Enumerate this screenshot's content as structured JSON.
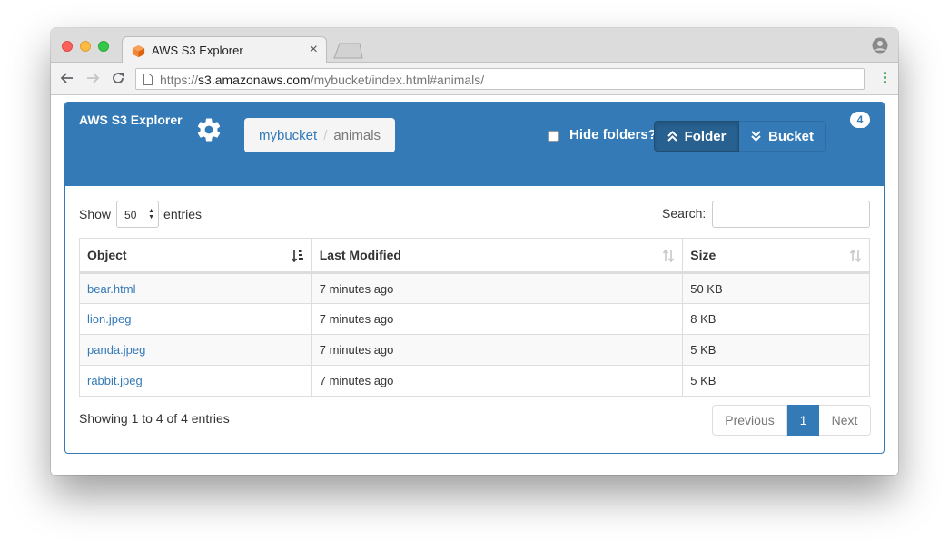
{
  "browser": {
    "tab_title": "AWS S3 Explorer",
    "tab_close": "×",
    "url_prefix": "https://",
    "url_host": "s3.amazonaws.com",
    "url_path": "/mybucket/index.html#animals/"
  },
  "header": {
    "brand": "AWS S3 Explorer",
    "breadcrumb": [
      "mybucket",
      "animals"
    ],
    "breadcrumb_sep": "/",
    "hide_folders_label": "Hide folders?",
    "hide_folders_checked": false,
    "folder_button": "Folder",
    "bucket_button": "Bucket",
    "object_count": "4"
  },
  "controls": {
    "show_label": "Show",
    "entries_value": "50",
    "entries_label": "entries",
    "search_label": "Search:",
    "search_value": ""
  },
  "table": {
    "columns": [
      "Object",
      "Last Modified",
      "Size"
    ],
    "rows": [
      {
        "object": "bear.html",
        "modified": "7 minutes ago",
        "size": "50 KB"
      },
      {
        "object": "lion.jpeg",
        "modified": "7 minutes ago",
        "size": "8 KB"
      },
      {
        "object": "panda.jpeg",
        "modified": "7 minutes ago",
        "size": "5 KB"
      },
      {
        "object": "rabbit.jpeg",
        "modified": "7 minutes ago",
        "size": "5 KB"
      }
    ]
  },
  "footer": {
    "info": "Showing 1 to 4 of 4 entries",
    "previous": "Previous",
    "current_page": "1",
    "next": "Next"
  },
  "colors": {
    "primary": "#337ab7",
    "primary_dark": "#286090",
    "link": "#337ab7",
    "favicon": "#f58536"
  },
  "icons": [
    "aws-s3-favicon",
    "close-icon",
    "user-profile-icon",
    "back-arrow-icon",
    "forward-arrow-icon",
    "reload-icon",
    "page-icon",
    "menu-icon",
    "gear-icon",
    "chevron-double-up-icon",
    "chevron-double-down-icon",
    "sort-icon"
  ]
}
